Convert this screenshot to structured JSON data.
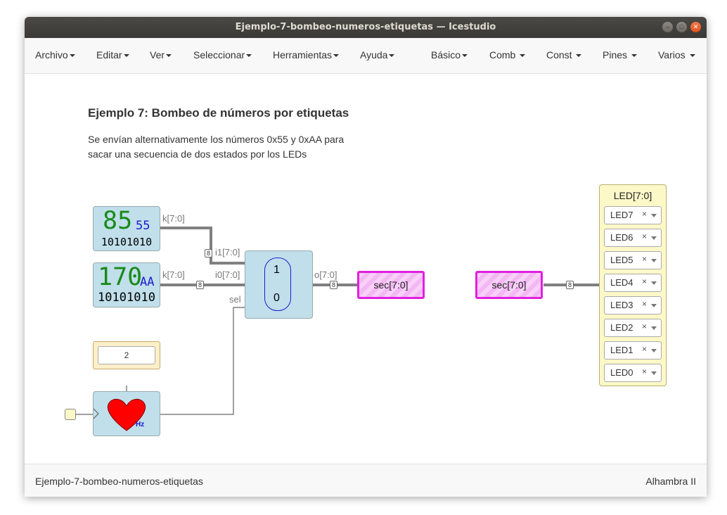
{
  "window": {
    "title": "Ejemplo-7-bombeo-numeros-etiquetas — Icestudio"
  },
  "menu_left": [
    "Archivo",
    "Editar",
    "Ver",
    "Seleccionar",
    "Herramientas",
    "Ayuda"
  ],
  "menu_right": [
    "Básico",
    "Comb",
    "Const",
    "Pines",
    "Varios"
  ],
  "canvas": {
    "heading": "Ejemplo 7: Bombeo de números por etiquetas",
    "description_line1": "Se envían alternativamente los números 0x55 y 0xAA para",
    "description_line2": "sacar una secuencia de dos estados por los LEDs",
    "const1": {
      "dec": "85",
      "hex": "55",
      "bin": "10101010",
      "port": "k[7:0]"
    },
    "const2": {
      "dec": "170",
      "hex": "AA",
      "bin": "10101010",
      "port": "k[7:0]"
    },
    "mux": {
      "in1": "i1[7:0]",
      "in0": "i0[7:0]",
      "sel": "sel",
      "out": "o[7:0]",
      "label_top": "1",
      "label_bottom": "0"
    },
    "bus_width": "8",
    "freq_value": "2",
    "freq_unit": "Hz",
    "tag_out": "sec[7:0]",
    "tag_in": "sec[7:0]",
    "led_panel": {
      "title": "LED[7:0]",
      "pins": [
        "LED7",
        "LED6",
        "LED5",
        "LED4",
        "LED3",
        "LED2",
        "LED1",
        "LED0"
      ],
      "remove_glyph": "×"
    }
  },
  "footer": {
    "left": "Ejemplo-7-bombeo-numeros-etiquetas",
    "right": "Alhambra II"
  },
  "colors": {
    "titlebar": "#3c3b37",
    "block": "#c0dfeb",
    "tag_border": "#e020e0",
    "heart": "#ff0000",
    "led_panel": "#fdf8c8"
  }
}
